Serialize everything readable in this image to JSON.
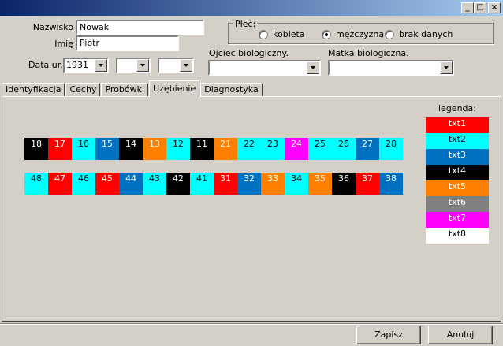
{
  "window": {
    "title": "",
    "minimize_glyph": "_",
    "maximize_glyph": "□",
    "close_glyph": "×"
  },
  "form": {
    "surname_label": "Nazwisko",
    "surname_value": "Nowak",
    "name_label": "Imię",
    "name_value": "Piotr",
    "birth_label": "Data ur.",
    "birth_year": "1931",
    "birth_month": "",
    "birth_day": "",
    "sex_label": "Płeć:",
    "sex_options": [
      "kobieta",
      "mężczyzna",
      "brak danych"
    ],
    "sex_selected": "mężczyzna",
    "father_label": "Ojciec biologiczny.",
    "father_value": "",
    "mother_label": "Matka biologiczna.",
    "mother_value": ""
  },
  "tabs": [
    {
      "label": "Identyfikacja"
    },
    {
      "label": "Cechy"
    },
    {
      "label": "Probówki"
    },
    {
      "label": "Uzębienie",
      "active": true
    },
    {
      "label": "Diagnostyka"
    }
  ],
  "colors": {
    "txt1": "#ff0000",
    "txt2": "#00ffff",
    "txt3": "#0070c0",
    "txt4": "#000000",
    "txt5": "#ff8000",
    "txt6": "#808080",
    "txt7": "#ff00ff",
    "txt8": "#ffffff"
  },
  "teeth": {
    "upper": [
      {
        "n": "18",
        "c": "txt4"
      },
      {
        "n": "17",
        "c": "txt1"
      },
      {
        "n": "16",
        "c": "txt2"
      },
      {
        "n": "15",
        "c": "txt3"
      },
      {
        "n": "14",
        "c": "txt4"
      },
      {
        "n": "13",
        "c": "txt5"
      },
      {
        "n": "12",
        "c": "txt2"
      },
      {
        "n": "11",
        "c": "txt4"
      },
      {
        "n": "21",
        "c": "txt5"
      },
      {
        "n": "22",
        "c": "txt2"
      },
      {
        "n": "23",
        "c": "txt2"
      },
      {
        "n": "24",
        "c": "txt7"
      },
      {
        "n": "25",
        "c": "txt2"
      },
      {
        "n": "26",
        "c": "txt2"
      },
      {
        "n": "27",
        "c": "txt3"
      },
      {
        "n": "28",
        "c": "txt2"
      }
    ],
    "lower": [
      {
        "n": "48",
        "c": "txt2"
      },
      {
        "n": "47",
        "c": "txt1"
      },
      {
        "n": "46",
        "c": "txt2"
      },
      {
        "n": "45",
        "c": "txt1"
      },
      {
        "n": "44",
        "c": "txt3"
      },
      {
        "n": "43",
        "c": "txt2"
      },
      {
        "n": "42",
        "c": "txt4"
      },
      {
        "n": "41",
        "c": "txt2"
      },
      {
        "n": "31",
        "c": "txt1"
      },
      {
        "n": "32",
        "c": "txt3"
      },
      {
        "n": "33",
        "c": "txt5"
      },
      {
        "n": "34",
        "c": "txt2"
      },
      {
        "n": "35",
        "c": "txt5"
      },
      {
        "n": "36",
        "c": "txt4"
      },
      {
        "n": "37",
        "c": "txt1"
      },
      {
        "n": "38",
        "c": "txt3"
      }
    ]
  },
  "legend": {
    "title": "legenda:",
    "items": [
      {
        "label": "txt1",
        "key": "txt1"
      },
      {
        "label": "txt2",
        "key": "txt2"
      },
      {
        "label": "txt3",
        "key": "txt3"
      },
      {
        "label": "txt4",
        "key": "txt4"
      },
      {
        "label": "txt5",
        "key": "txt5"
      },
      {
        "label": "txt6",
        "key": "txt6"
      },
      {
        "label": "txt7",
        "key": "txt7"
      },
      {
        "label": "txt8",
        "key": "txt8"
      }
    ]
  },
  "buttons": {
    "save": "Zapisz",
    "cancel": "Anuluj"
  }
}
